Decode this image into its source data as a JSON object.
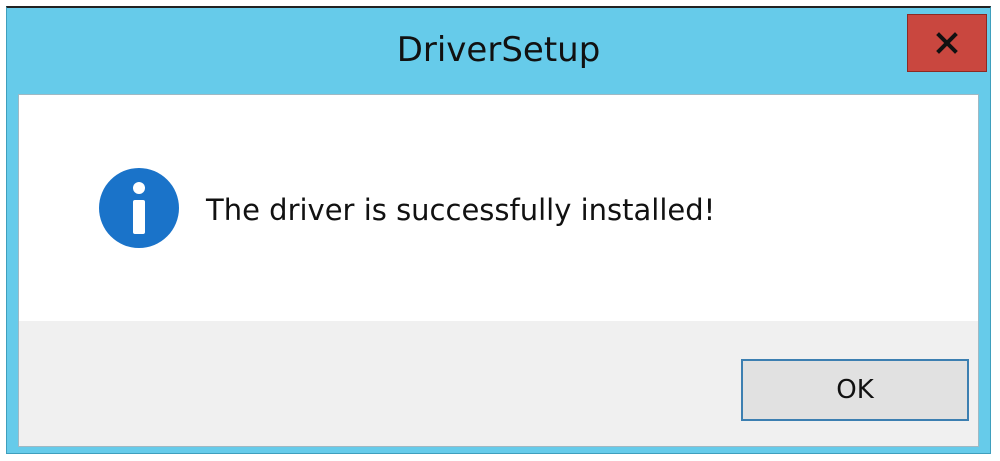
{
  "window": {
    "title": "DriverSetup",
    "close_icon": "close-icon",
    "accent_color": "#66cbea",
    "close_color": "#c9473f"
  },
  "message": {
    "icon": "info-icon",
    "icon_color": "#1a73c9",
    "text": "The driver is successfully installed!"
  },
  "buttons": {
    "ok_label": "OK"
  }
}
